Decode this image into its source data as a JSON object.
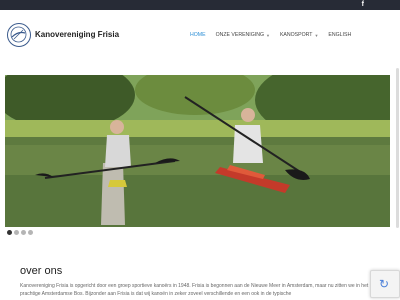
{
  "topbar": {
    "social_icon": "f"
  },
  "header": {
    "brand": "Kanovereniging Frisia"
  },
  "nav": [
    {
      "label": "HOME",
      "active": true,
      "dropdown": false
    },
    {
      "label": "ONZE VERENIGING",
      "active": false,
      "dropdown": true
    },
    {
      "label": "KANOSPORT",
      "active": false,
      "dropdown": true
    },
    {
      "label": "ENGLISH",
      "active": false,
      "dropdown": false
    }
  ],
  "slider": {
    "slide_count": 4,
    "active_index": 0
  },
  "about": {
    "title": "over ons",
    "text": "Kanovereniging Frisia is opgericht door een groep sportieve kanoërs in 1948. Frisia is begonnen aan de Nieuwe Meer in Amsterdam, maar nu zitten we in het prachtige Amsterdamse Bos. Bijzonder aan Frisia is dat wij kanoën in zeker zoveel verschillende en een ook in de typische"
  },
  "colors": {
    "accent": "#2c8fd6",
    "topbar": "#272b36"
  },
  "icons": {
    "social": "facebook-icon",
    "captcha": "recaptcha-icon"
  }
}
